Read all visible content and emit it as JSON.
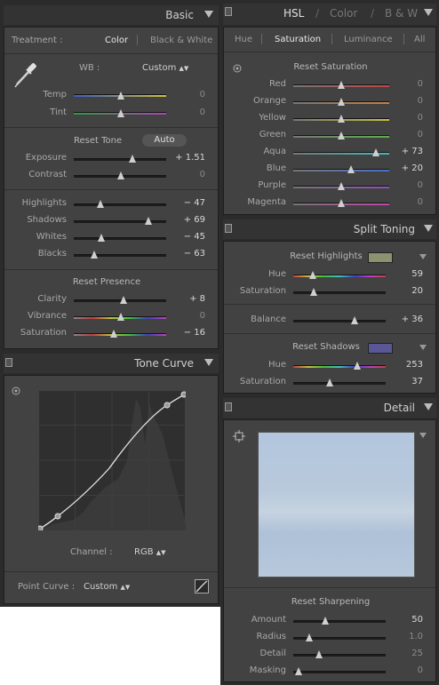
{
  "basic": {
    "title": "Basic",
    "treatment_label": "Treatment :",
    "treatment_color": "Color",
    "treatment_bw": "Black & White",
    "wb_label": "WB :",
    "wb_value": "Custom",
    "temp": {
      "label": "Temp",
      "value": "0"
    },
    "tint": {
      "label": "Tint",
      "value": "0"
    },
    "reset_tone": "Reset Tone",
    "auto": "Auto",
    "exposure": {
      "label": "Exposure",
      "value": "+ 1.51"
    },
    "contrast": {
      "label": "Contrast",
      "value": "0"
    },
    "highlights": {
      "label": "Highlights",
      "value": "− 47"
    },
    "shadows": {
      "label": "Shadows",
      "value": "+ 69"
    },
    "whites": {
      "label": "Whites",
      "value": "− 45"
    },
    "blacks": {
      "label": "Blacks",
      "value": "− 63"
    },
    "reset_presence": "Reset Presence",
    "clarity": {
      "label": "Clarity",
      "value": "+ 8"
    },
    "vibrance": {
      "label": "Vibrance",
      "value": "0"
    },
    "saturation": {
      "label": "Saturation",
      "value": "− 16"
    }
  },
  "tone_curve": {
    "title": "Tone Curve",
    "channel_label": "Channel :",
    "channel_value": "RGB",
    "point_curve_label": "Point Curve :",
    "point_curve_value": "Custom"
  },
  "hsl": {
    "tab_hsl": "HSL",
    "tab_color": "Color",
    "tab_bw": "B & W",
    "slash": "/",
    "sub_hue": "Hue",
    "sub_saturation": "Saturation",
    "sub_luminance": "Luminance",
    "sub_all": "All",
    "reset": "Reset Saturation",
    "rows": [
      {
        "label": "Red",
        "value": "0",
        "pos": 0.5,
        "color": "#c04848"
      },
      {
        "label": "Orange",
        "value": "0",
        "pos": 0.5,
        "color": "#c88040"
      },
      {
        "label": "Yellow",
        "value": "0",
        "pos": 0.5,
        "color": "#c8c040"
      },
      {
        "label": "Green",
        "value": "0",
        "pos": 0.5,
        "color": "#58b048"
      },
      {
        "label": "Aqua",
        "value": "+ 73",
        "pos": 0.865,
        "color": "#40b8b8"
      },
      {
        "label": "Blue",
        "value": "+ 20",
        "pos": 0.6,
        "color": "#4870c8"
      },
      {
        "label": "Purple",
        "value": "0",
        "pos": 0.5,
        "color": "#9050c0"
      },
      {
        "label": "Magenta",
        "value": "0",
        "pos": 0.5,
        "color": "#c048a8"
      }
    ]
  },
  "split_toning": {
    "title": "Split Toning",
    "reset_highlights": "Reset Highlights",
    "highlight_swatch": "#8e9170",
    "hl_hue": {
      "label": "Hue",
      "value": "59"
    },
    "hl_sat": {
      "label": "Saturation",
      "value": "20"
    },
    "balance": {
      "label": "Balance",
      "value": "+ 36"
    },
    "reset_shadows": "Reset Shadows",
    "shadow_swatch": "#5b5796",
    "sh_hue": {
      "label": "Hue",
      "value": "253"
    },
    "sh_sat": {
      "label": "Saturation",
      "value": "37"
    }
  },
  "detail": {
    "title": "Detail",
    "reset_sharpening": "Reset Sharpening",
    "amount": {
      "label": "Amount",
      "value": "50"
    },
    "radius": {
      "label": "Radius",
      "value": "1.0"
    },
    "detail": {
      "label": "Detail",
      "value": "25"
    },
    "masking": {
      "label": "Masking",
      "value": "0"
    }
  }
}
